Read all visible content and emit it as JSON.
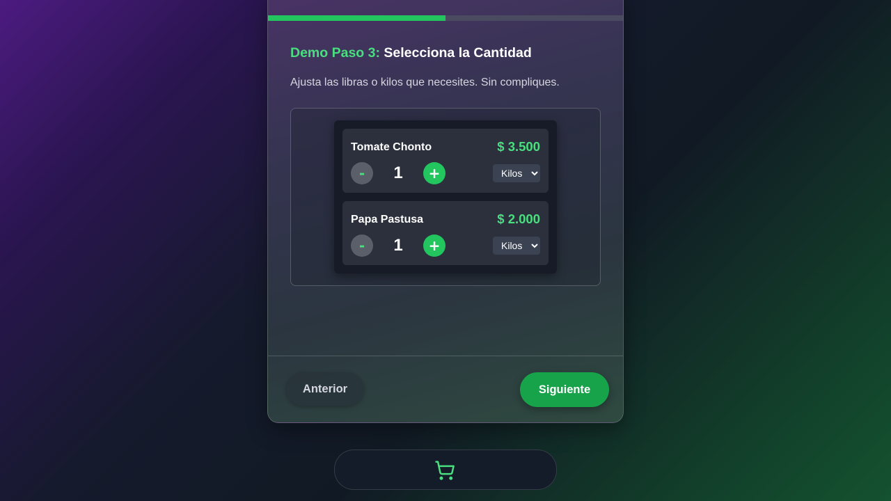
{
  "progress": {
    "value": 0.5,
    "color": "#22c55e"
  },
  "step": {
    "prefix": "Demo Paso 3:",
    "title": "Selecciona la Cantidad",
    "description": "Ajusta las libras o kilos que necesites. Sin compliques."
  },
  "products": [
    {
      "name": "Tomate Chonto",
      "price": "$ 3.500",
      "minus": "-",
      "quantity": "1",
      "plus": "+",
      "unit": "Kilos"
    },
    {
      "name": "Papa Pastusa",
      "price": "$ 2.000",
      "minus": "-",
      "quantity": "1",
      "plus": "+",
      "unit": "Kilos"
    }
  ],
  "navigation": {
    "prev_label": "Anterior",
    "next_label": "Siguiente"
  },
  "cart": {
    "icon": "cart-icon"
  },
  "colors": {
    "accent": "#4ade80",
    "primary_button": "#16a34a"
  }
}
